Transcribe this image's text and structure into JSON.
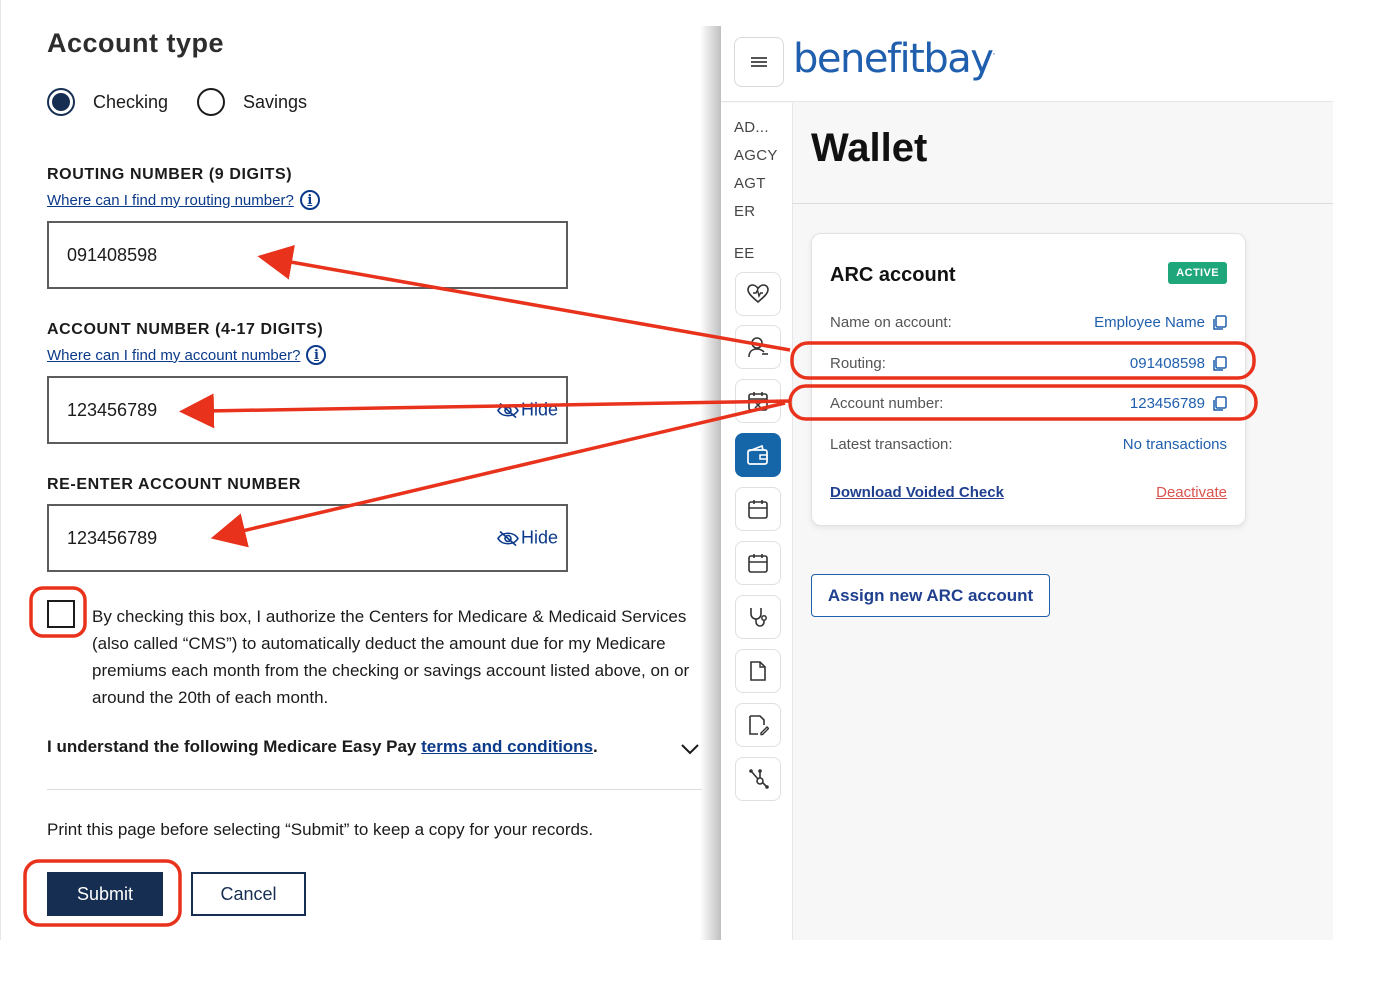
{
  "form": {
    "section_title": "Account type",
    "account_types": [
      {
        "label": "Checking",
        "selected": true
      },
      {
        "label": "Savings",
        "selected": false
      }
    ],
    "routing": {
      "label": "ROUTING NUMBER (9 DIGITS)",
      "help": "Where can I find my routing number?",
      "value": "091408598"
    },
    "account": {
      "label": "ACCOUNT NUMBER (4-17 DIGITS)",
      "help": "Where can I find my account number?",
      "value": "123456789",
      "hide_label": "Hide"
    },
    "reenter": {
      "label": "RE-ENTER ACCOUNT NUMBER",
      "value": "123456789",
      "hide_label": "Hide"
    },
    "consent_text": "By checking this box, I authorize the Centers for Medicare & Medicaid Services (also called “CMS”) to automatically deduct the amount due for my Medicare premiums each month from the checking or savings account listed above, on or around the 20th of each month.",
    "terms_prefix": "I understand the following Medicare Easy Pay",
    "terms_link": "terms and conditions",
    "terms_suffix": ".",
    "print_note": "Print this page before selecting “Submit” to keep a copy for your records.",
    "submit_label": "Submit",
    "cancel_label": "Cancel"
  },
  "app": {
    "brand": "benefitbay",
    "brand_mark": "·",
    "page_title": "Wallet",
    "nav_text": [
      "AD...",
      "AGCY",
      "AGT",
      "ER",
      "EE"
    ],
    "nav_icons": [
      "heart-icon",
      "user-icon",
      "calendar-x-icon",
      "wallet-icon",
      "calendar-icon",
      "calendar-icon",
      "stethoscope-icon",
      "document-icon",
      "document-edit-icon",
      "hub-icon"
    ],
    "card": {
      "title": "ARC account",
      "badge": "ACTIVE",
      "rows": [
        {
          "key": "Name on account:",
          "value": "Employee Name"
        },
        {
          "key": "Routing:",
          "value": "091408598"
        },
        {
          "key": "Account number:",
          "value": "123456789"
        },
        {
          "key": "Latest transaction:",
          "value": "No transactions"
        }
      ],
      "download_label": "Download Voided Check",
      "deactivate_label": "Deactivate"
    },
    "assign_button": "Assign new ARC account"
  },
  "colors": {
    "annotation": "#e8321c",
    "medicare_navy": "#162e51",
    "link_blue": "#0b3a8a",
    "brand_blue": "#1f5fae",
    "active_green": "#1fa67a",
    "deactivate_red": "#d9534f"
  }
}
